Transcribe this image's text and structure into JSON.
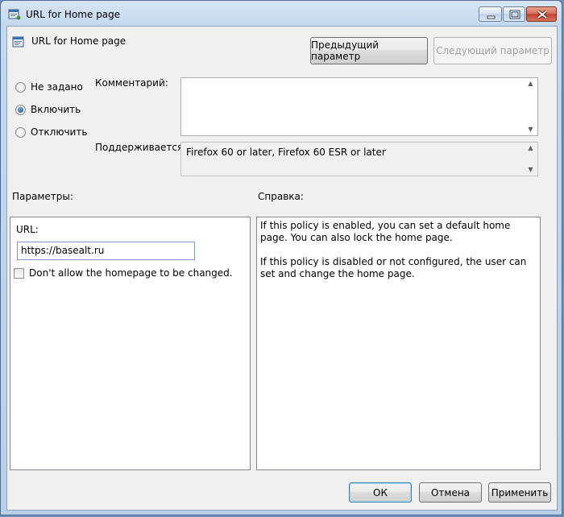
{
  "window": {
    "title": "URL for Home page"
  },
  "header": {
    "policy_name": "URL for Home page",
    "prev_button": "Предыдущий параметр",
    "next_button": "Следующий параметр"
  },
  "state": {
    "options": [
      {
        "label": "Не задано",
        "selected": false
      },
      {
        "label": "Включить",
        "selected": true
      },
      {
        "label": "Отключить",
        "selected": false
      }
    ]
  },
  "comment": {
    "label": "Комментарий:",
    "value": ""
  },
  "supported": {
    "label": "Поддерживается:",
    "value": "Firefox 60 or later, Firefox 60 ESR or later"
  },
  "params": {
    "title": "Параметры:",
    "url_label": "URL:",
    "url_value": "https://basealt.ru",
    "checkbox_label": "Don't allow the homepage to be changed.",
    "checkbox_checked": false
  },
  "help": {
    "title": "Справка:",
    "paragraph1": "If this policy is enabled, you can set a default home page. You can also lock the home page.",
    "paragraph2": "If this policy is disabled or not configured, the user can set and change the home page."
  },
  "footer": {
    "ok": "ОК",
    "cancel": "Отмена",
    "apply": "Применить"
  }
}
